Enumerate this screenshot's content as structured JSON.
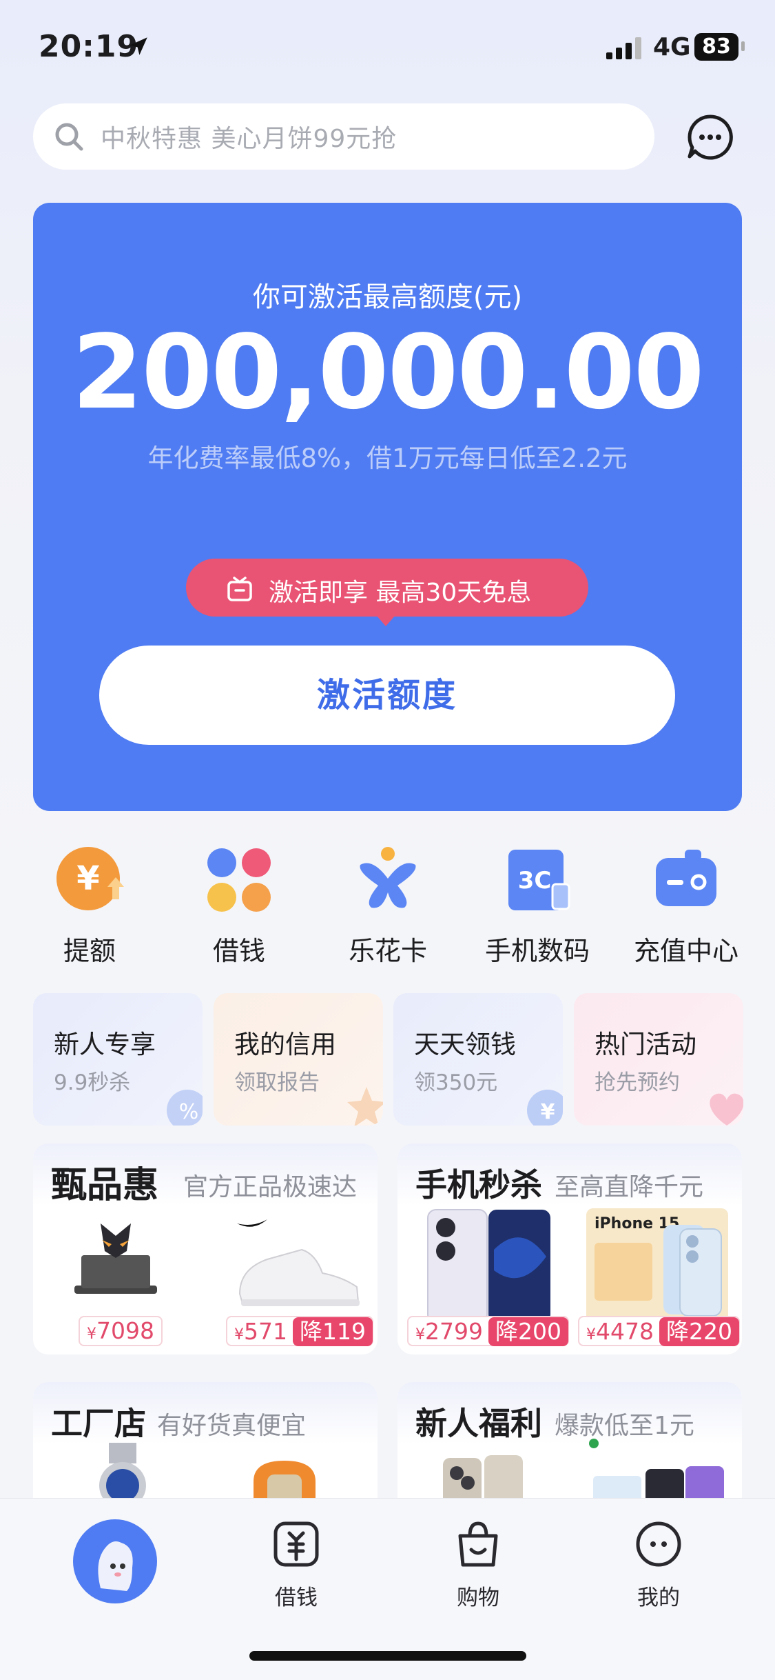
{
  "status": {
    "time": "20:19",
    "network": "4G",
    "battery": "83"
  },
  "search": {
    "placeholder": "中秋特惠 美心月饼99元抢"
  },
  "hero": {
    "caption": "你可激活最高额度(元)",
    "amount": "200,000.00",
    "rate_text": "年化费率最低8%，借1万元每日低至2.2元",
    "promo": "激活即享 最高30天免息",
    "button": "激活额度"
  },
  "quick_entries": [
    {
      "label": "提额",
      "icon": "raise-limit-icon"
    },
    {
      "label": "借钱",
      "icon": "borrow-clover-icon"
    },
    {
      "label": "乐花卡",
      "icon": "lehua-card-icon"
    },
    {
      "label": "手机数码",
      "icon": "3c-digital-icon"
    },
    {
      "label": "充值中心",
      "icon": "recharge-icon"
    }
  ],
  "mini_cards": [
    {
      "title": "新人专享",
      "sub": "9.9秒杀"
    },
    {
      "title": "我的信用",
      "sub": "领取报告"
    },
    {
      "title": "天天领钱",
      "sub": "领350元"
    },
    {
      "title": "热门活动",
      "sub": "抢先预约"
    }
  ],
  "products": [
    {
      "title": "甄品惠",
      "sub": "官方正品极速达",
      "items": [
        {
          "price": "7098",
          "cut": ""
        },
        {
          "price": "571",
          "cut": "降119"
        }
      ]
    },
    {
      "title": "手机秒杀",
      "sub": "至高直降千元",
      "items": [
        {
          "price": "2799",
          "cut": "降200"
        },
        {
          "price": "4478",
          "cut": "降220"
        }
      ],
      "poster_text": "iPhone 15"
    },
    {
      "title": "工厂店",
      "sub": "有好货真便宜"
    },
    {
      "title": "新人福利",
      "sub": "爆款低至1元"
    }
  ],
  "currency": "¥",
  "tabs": [
    {
      "label": ""
    },
    {
      "label": "借钱"
    },
    {
      "label": "购物"
    },
    {
      "label": "我的"
    }
  ],
  "colors": {
    "brand_blue": "#4f7cf2",
    "promo_pink": "#e95474",
    "price_red": "#e24a6b"
  }
}
